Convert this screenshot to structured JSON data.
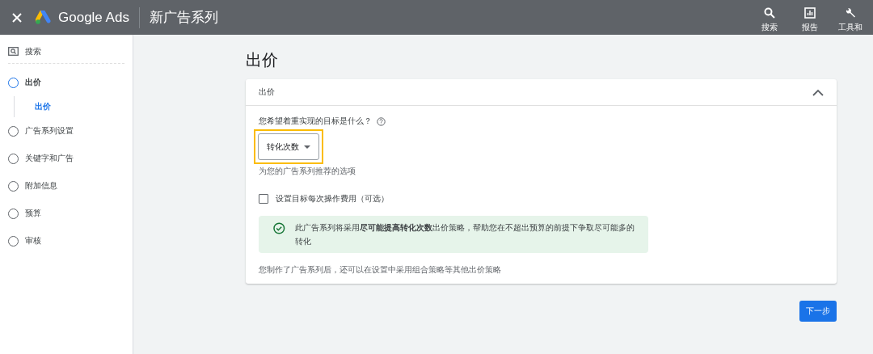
{
  "header": {
    "product": "Google Ads",
    "title": "新广告系列",
    "actions": [
      {
        "kind": "search",
        "label": "搜索"
      },
      {
        "kind": "report",
        "label": "报告"
      },
      {
        "kind": "tools",
        "label": "工具和"
      }
    ]
  },
  "sidebar": {
    "search": "搜索",
    "steps": [
      {
        "label": "出价",
        "selected": true,
        "children": [
          {
            "label": "出价",
            "selected": true
          }
        ]
      },
      {
        "label": "广告系列设置",
        "selected": false
      },
      {
        "label": "关键字和广告",
        "selected": false
      },
      {
        "label": "附加信息",
        "selected": false
      },
      {
        "label": "预算",
        "selected": false
      },
      {
        "label": "审核",
        "selected": false
      }
    ]
  },
  "page_title": "出价",
  "card": {
    "title": "出价",
    "expanded": true,
    "question": "您希望着重实现的目标是什么？",
    "dropdown": {
      "value": "转化次数",
      "highlighted": true
    },
    "hint": "为您的广告系列推荐的选项",
    "checkbox": {
      "label": "设置目标每次操作费用（可选）",
      "checked": false
    },
    "notice": "此广告系列将采用**尽可能提高转化次数**出价策略，帮助您在不超出预算的前提下争取尽可能多的转化",
    "footer": "您制作了广告系列后，还可以在设置中采用组合策略等其他出价策略"
  },
  "next_button": "下一步"
}
